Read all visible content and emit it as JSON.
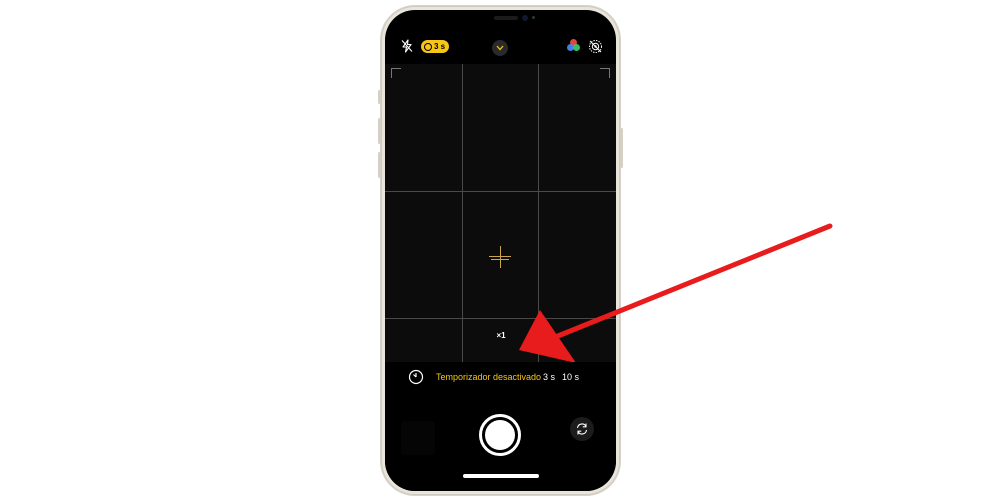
{
  "camera": {
    "timer_badge": "3 s",
    "zoom": "×1",
    "timer_options": {
      "off_label": "Temporizador desactivado",
      "three_label": "3 s",
      "ten_label": "10 s",
      "selected": "Temporizador desactivado"
    }
  },
  "colors": {
    "accent_yellow": "#f5c518",
    "annotation_arrow": "#e81c1c",
    "screen_background": "#000000",
    "frame": "#e9e5dc"
  },
  "icons": {
    "flash": "flash-off-icon",
    "timer_indicator": "timer-icon",
    "controls_toggle": "chevron-up-icon",
    "filters": "filters-icon",
    "live_photo": "live-photo-off-icon",
    "timer_toggle": "timer-icon",
    "camera_switch": "camera-flip-icon"
  }
}
